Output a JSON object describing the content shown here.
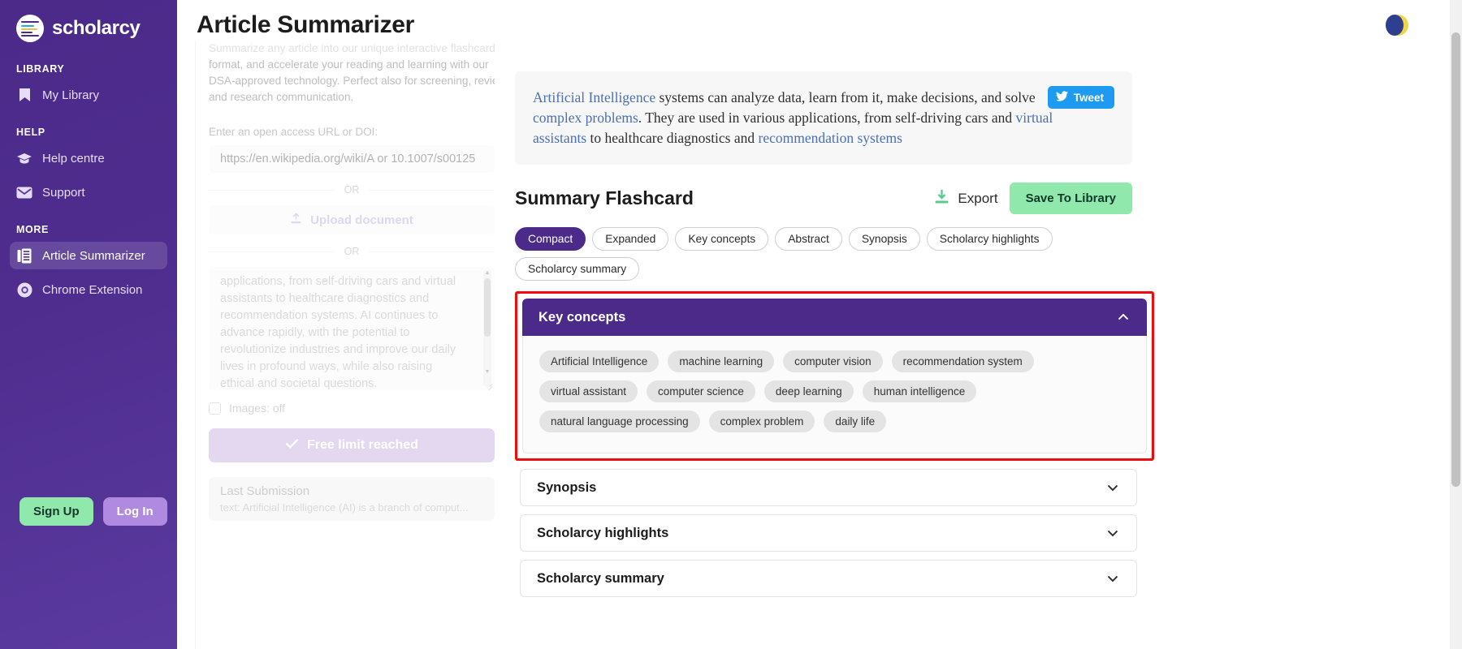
{
  "sidebar": {
    "brand": "scholarcy",
    "sections": [
      {
        "title": "LIBRARY",
        "items": [
          {
            "label": "My Library",
            "icon": "bookmark-icon",
            "active": false
          }
        ]
      },
      {
        "title": "HELP",
        "items": [
          {
            "label": "Help centre",
            "icon": "graduation-cap-icon",
            "active": false
          },
          {
            "label": "Support",
            "icon": "envelope-icon",
            "active": false
          }
        ]
      },
      {
        "title": "MORE",
        "items": [
          {
            "label": "Article Summarizer",
            "icon": "document-list-icon",
            "active": true
          },
          {
            "label": "Chrome Extension",
            "icon": "chrome-icon",
            "active": false
          }
        ]
      }
    ],
    "sign_up": "Sign Up",
    "log_in": "Log In"
  },
  "header": {
    "title": "Article Summarizer",
    "theme_toggle_icon": "moon-sun-icon"
  },
  "form_panel": {
    "intro_line1": "Summarize any article into our unique interactive flashcard",
    "intro_line2": "format, and accelerate your reading and learning with our",
    "intro_line3": "DSA-approved technology. Perfect also for screening, review",
    "intro_line4": "and research communication.",
    "url_label": "Enter an open access URL or DOI:",
    "url_placeholder": "https://en.wikipedia.org/wiki/A or 10.1007/s00125",
    "url_value": "",
    "or_1": "OR",
    "or_2": "OR",
    "upload_label": "Upload document",
    "upload_icon": "upload-icon",
    "textarea_line1": "applications, from self-driving cars and virtual",
    "textarea_line2": "assistants to healthcare diagnostics and",
    "textarea_line3": "recommendation systems. AI continues to",
    "textarea_line4": "advance rapidly, with the potential to",
    "textarea_line5": "revolutionize industries and improve our daily",
    "textarea_line6": "lives in profound ways, while also raising",
    "textarea_line7": "ethical and societal questions.",
    "images_label": "Images: off",
    "images_checked": false,
    "submit_label": "Free limit reached",
    "submit_icon": "check-icon",
    "last_submission_title": "Last Submission",
    "last_submission_text": "text: Artificial Intelligence (AI) is a branch of comput..."
  },
  "summary": {
    "parts": [
      {
        "text": "Artificial Intelligence",
        "link": true
      },
      {
        "text": " systems can analyze data, learn from it, make decisions, and ",
        "link": false
      },
      {
        "text": "solve ",
        "link": false
      },
      {
        "text": "complex problems",
        "link": true
      },
      {
        "text": ". They are used in various applications, from self-driving cars ",
        "link": false
      },
      {
        "text": "and ",
        "link": false
      },
      {
        "text": "virtual assistants",
        "link": true
      },
      {
        "text": " to healthcare diagnostics and ",
        "link": false
      },
      {
        "text": "recommendation systems",
        "link": true
      }
    ],
    "tweet_label": "Tweet",
    "tweet_icon": "twitter-bird-icon"
  },
  "flashcard": {
    "title": "Summary Flashcard",
    "export_label": "Export",
    "export_icon": "download-icon",
    "save_label": "Save To Library",
    "tabs": [
      {
        "label": "Compact",
        "active": true
      },
      {
        "label": "Expanded",
        "active": false
      },
      {
        "label": "Key concepts",
        "active": false
      },
      {
        "label": "Abstract",
        "active": false
      },
      {
        "label": "Synopsis",
        "active": false
      },
      {
        "label": "Scholarcy highlights",
        "active": false
      },
      {
        "label": "Scholarcy summary",
        "active": false
      }
    ],
    "open_section": {
      "title": "Key concepts",
      "chevron_icon": "chevron-up-icon",
      "chips": [
        "Artificial Intelligence",
        "machine learning",
        "computer vision",
        "recommendation system",
        "virtual assistant",
        "computer science",
        "deep learning",
        "human intelligence",
        "natural language processing",
        "complex problem",
        "daily life"
      ]
    },
    "closed_sections": [
      {
        "title": "Synopsis",
        "chevron_icon": "chevron-down-icon"
      },
      {
        "title": "Scholarcy highlights",
        "chevron_icon": "chevron-down-icon"
      },
      {
        "title": "Scholarcy summary",
        "chevron_icon": "chevron-down-icon"
      }
    ]
  },
  "colors": {
    "brand_purple": "#4b2a8a",
    "accent_green": "#90e8ac",
    "twitter_blue": "#1d9bf0",
    "highlight_red": "#f00c0c",
    "link_blue": "#4a6fb5"
  }
}
